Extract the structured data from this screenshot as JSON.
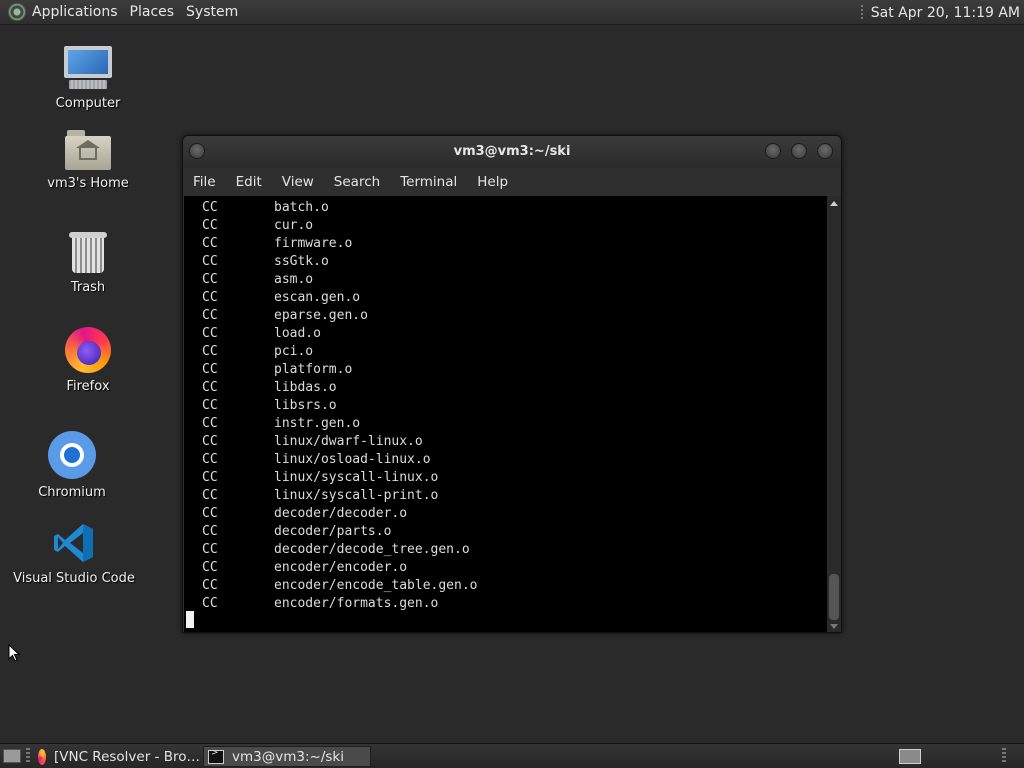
{
  "top_panel": {
    "menus": [
      "Applications",
      "Places",
      "System"
    ],
    "clock": "Sat Apr 20, 11:19 AM"
  },
  "desktop": {
    "icons": [
      {
        "label": "Computer",
        "icon": "computer-icon"
      },
      {
        "label": "vm3's Home",
        "icon": "home-folder-icon"
      },
      {
        "label": "Trash",
        "icon": "trash-icon"
      },
      {
        "label": "Firefox",
        "icon": "firefox-icon"
      },
      {
        "label": "Chromium",
        "icon": "chromium-icon"
      },
      {
        "label": "Visual Studio Code",
        "icon": "vscode-icon"
      }
    ]
  },
  "terminal": {
    "title": "vm3@vm3:~/ski",
    "menus": [
      "File",
      "Edit",
      "View",
      "Search",
      "Terminal",
      "Help"
    ],
    "lines": [
      {
        "cmd": "CC",
        "file": "batch.o"
      },
      {
        "cmd": "CC",
        "file": "cur.o"
      },
      {
        "cmd": "CC",
        "file": "firmware.o"
      },
      {
        "cmd": "CC",
        "file": "ssGtk.o"
      },
      {
        "cmd": "CC",
        "file": "asm.o"
      },
      {
        "cmd": "CC",
        "file": "escan.gen.o"
      },
      {
        "cmd": "CC",
        "file": "eparse.gen.o"
      },
      {
        "cmd": "CC",
        "file": "load.o"
      },
      {
        "cmd": "CC",
        "file": "pci.o"
      },
      {
        "cmd": "CC",
        "file": "platform.o"
      },
      {
        "cmd": "CC",
        "file": "libdas.o"
      },
      {
        "cmd": "CC",
        "file": "libsrs.o"
      },
      {
        "cmd": "CC",
        "file": "instr.gen.o"
      },
      {
        "cmd": "CC",
        "file": "linux/dwarf-linux.o"
      },
      {
        "cmd": "CC",
        "file": "linux/osload-linux.o"
      },
      {
        "cmd": "CC",
        "file": "linux/syscall-linux.o"
      },
      {
        "cmd": "CC",
        "file": "linux/syscall-print.o"
      },
      {
        "cmd": "CC",
        "file": "decoder/decoder.o"
      },
      {
        "cmd": "CC",
        "file": "decoder/parts.o"
      },
      {
        "cmd": "CC",
        "file": "decoder/decode_tree.gen.o"
      },
      {
        "cmd": "CC",
        "file": "encoder/encoder.o"
      },
      {
        "cmd": "CC",
        "file": "encoder/encode_table.gen.o"
      },
      {
        "cmd": "CC",
        "file": "encoder/formats.gen.o"
      }
    ]
  },
  "taskbar": {
    "tasks": [
      {
        "label": "[VNC Resolver - Bro…",
        "icon": "firefox-icon"
      },
      {
        "label": "vm3@vm3:~/ski",
        "icon": "terminal-icon"
      }
    ]
  }
}
